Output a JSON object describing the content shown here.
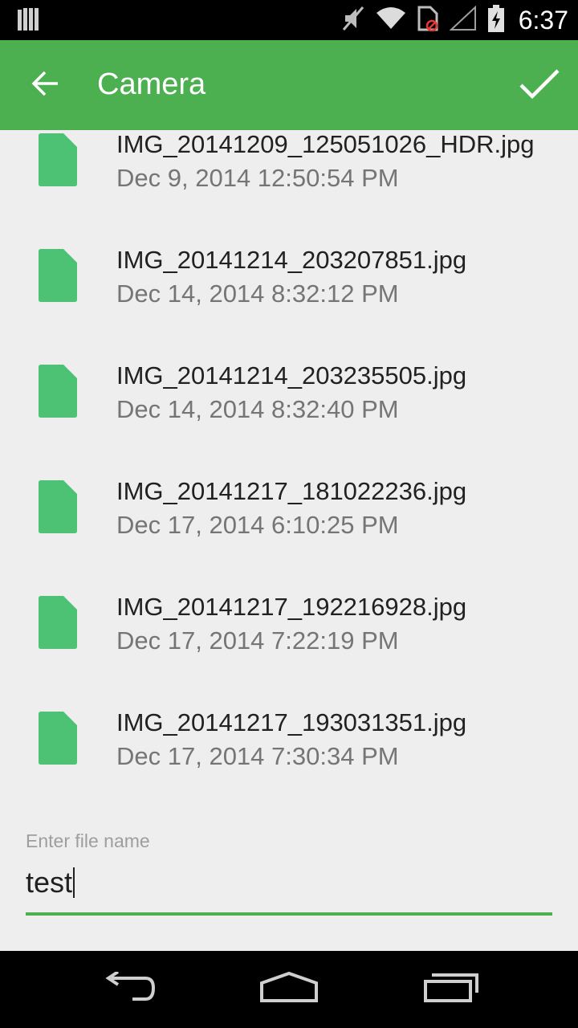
{
  "status_bar": {
    "time": "6:37",
    "icons": [
      "notification-icon",
      "mute-icon",
      "wifi-icon",
      "no-sim-icon",
      "signal-icon",
      "battery-charging-icon"
    ]
  },
  "app_bar": {
    "title": "Camera",
    "back_icon": "arrow-back-icon",
    "confirm_icon": "check-icon",
    "color": "#4caf50"
  },
  "files": [
    {
      "name": "IMG_20141209_125051026_HDR.jpg",
      "date": "Dec 9, 2014 12:50:54 PM"
    },
    {
      "name": "IMG_20141214_203207851.jpg",
      "date": "Dec 14, 2014 8:32:12 PM"
    },
    {
      "name": "IMG_20141214_203235505.jpg",
      "date": "Dec 14, 2014 8:32:40 PM"
    },
    {
      "name": "IMG_20141217_181022236.jpg",
      "date": "Dec 17, 2014 6:10:25 PM"
    },
    {
      "name": "IMG_20141217_192216928.jpg",
      "date": "Dec 17, 2014 7:22:19 PM"
    },
    {
      "name": "IMG_20141217_193031351.jpg",
      "date": "Dec 17, 2014 7:30:34 PM"
    }
  ],
  "file_icon": "file-icon",
  "file_icon_color": "#4dc275",
  "filename_input": {
    "placeholder": "Enter file name",
    "value": "test"
  },
  "nav_bar": {
    "icons": [
      "back-nav-icon",
      "home-nav-icon",
      "recents-nav-icon"
    ]
  }
}
